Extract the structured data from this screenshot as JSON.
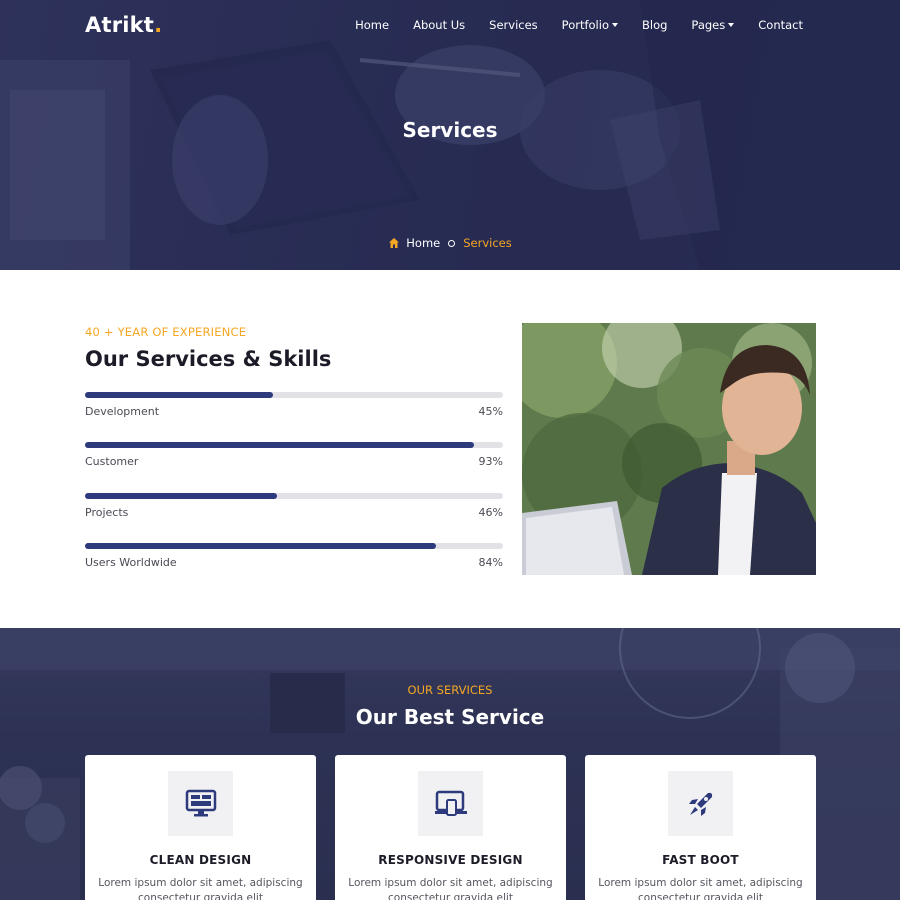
{
  "brand": {
    "name": "Atrikt",
    "dot": "."
  },
  "nav": {
    "items": [
      {
        "label": "Home",
        "dropdown": false
      },
      {
        "label": "About Us",
        "dropdown": false
      },
      {
        "label": "Services",
        "dropdown": false
      },
      {
        "label": "Portfolio",
        "dropdown": true
      },
      {
        "label": "Blog",
        "dropdown": false
      },
      {
        "label": "Pages",
        "dropdown": true
      },
      {
        "label": "Contact",
        "dropdown": false
      }
    ]
  },
  "hero": {
    "title": "Services",
    "breadcrumb": {
      "home": "Home",
      "current": "Services",
      "home_icon": "home-icon"
    }
  },
  "skills": {
    "eyebrow": "40 + YEAR OF EXPERIENCE",
    "title": "Our Services & Skills",
    "items": [
      {
        "label": "Development",
        "value": 45,
        "display": "45%"
      },
      {
        "label": "Customer",
        "value": 93,
        "display": "93%"
      },
      {
        "label": "Projects",
        "value": 46,
        "display": "46%"
      },
      {
        "label": "Users Worldwide",
        "value": 84,
        "display": "84%"
      }
    ]
  },
  "services": {
    "eyebrow": "OUR SERVICES",
    "title": "Our Best Service",
    "cards": [
      {
        "title": "CLEAN DESIGN",
        "icon": "monitor-icon",
        "text": "Lorem ipsum dolor sit amet, adipiscing consectetur gravida elit"
      },
      {
        "title": "RESPONSIVE DESIGN",
        "icon": "devices-icon",
        "text": "Lorem ipsum dolor sit amet, adipiscing consectetur gravida elit"
      },
      {
        "title": "FAST BOOT",
        "icon": "rocket-icon",
        "text": "Lorem ipsum dolor sit amet, adipiscing consectetur gravida elit"
      }
    ]
  },
  "colors": {
    "accent": "#f5a623",
    "primary": "#2d3a7c",
    "hero_overlay": "#2b3056",
    "track": "#e2e2e6"
  }
}
